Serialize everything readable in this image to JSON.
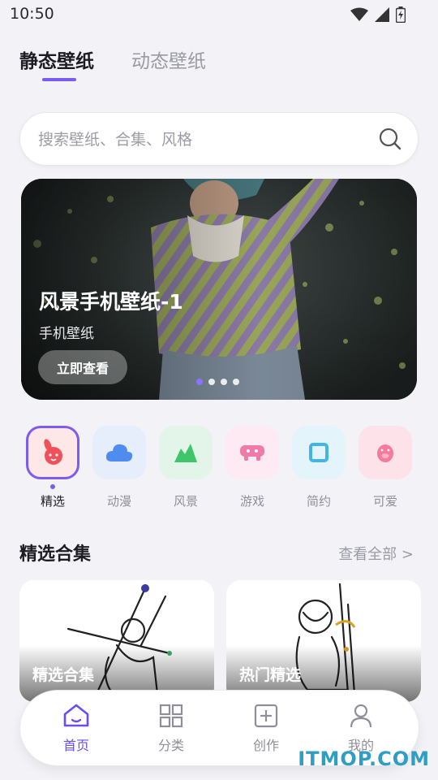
{
  "status_bar": {
    "time": "10:50"
  },
  "tabs": [
    {
      "label": "静态壁纸"
    },
    {
      "label": "动态壁纸"
    }
  ],
  "search": {
    "placeholder": "搜索壁纸、合集、风格"
  },
  "banner": {
    "title": "风景手机壁纸-1",
    "subtitle": "手机壁纸",
    "button_label": "立即查看",
    "page_count": 4,
    "active_page": 1
  },
  "categories": [
    {
      "label": "精选",
      "icon": "rabbit-icon",
      "bg": "#fde7e7",
      "color": "#f0505a"
    },
    {
      "label": "动漫",
      "icon": "cloud-icon",
      "bg": "#e6eefc",
      "color": "#4f8cf0"
    },
    {
      "label": "风景",
      "icon": "mountain-icon",
      "bg": "#e3f4e8",
      "color": "#3fc56a"
    },
    {
      "label": "游戏",
      "icon": "gamepad-icon",
      "bg": "#fdeaf2",
      "color": "#f07aa8"
    },
    {
      "label": "简约",
      "icon": "square-icon",
      "bg": "#e4f4fb",
      "color": "#42b4e6"
    },
    {
      "label": "可爱",
      "icon": "pig-icon",
      "bg": "#fde2ea",
      "color": "#f57a9c"
    }
  ],
  "collections": {
    "title": "精选合集",
    "see_all": "查看全部 >",
    "cards": [
      {
        "title": "精选合集"
      },
      {
        "title": "热门精选"
      }
    ]
  },
  "bottom_nav": [
    {
      "label": "首页",
      "icon": "home-icon"
    },
    {
      "label": "分类",
      "icon": "grid-icon"
    },
    {
      "label": "创作",
      "icon": "plus-square-icon"
    },
    {
      "label": "我的",
      "icon": "user-icon"
    }
  ],
  "colors": {
    "accent": "#7b5cf0"
  },
  "watermark": "ITMOP.COM"
}
